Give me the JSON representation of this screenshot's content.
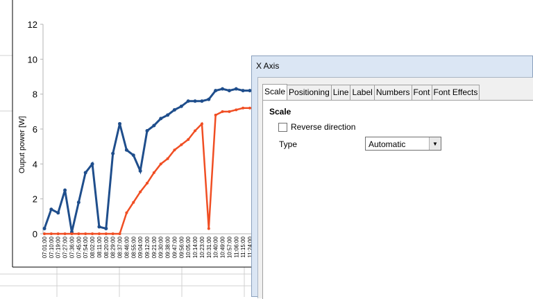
{
  "chart_data": {
    "type": "line",
    "ylabel": "Ouput power [W]",
    "ylim": [
      0,
      12
    ],
    "yticks": [
      "0",
      "2",
      "4",
      "6",
      "8",
      "10",
      "12"
    ],
    "xticks": [
      "07:01:00",
      "07:10:00",
      "07:19:00",
      "07:27:00",
      "07:36:00",
      "07:45:00",
      "07:54:00",
      "08:02:00",
      "08:11:00",
      "08:20:00",
      "08:29:00",
      "08:37:00",
      "08:46:00",
      "08:55:00",
      "09:04:00",
      "09:12:00",
      "09:21:00",
      "09:30:00",
      "09:38:00",
      "09:47:00",
      "09:56:00",
      "10:05:00",
      "10:14:00",
      "10:23:00",
      "10:31:00",
      "10:40:00",
      "10:49:00",
      "10:57:00",
      "11:06:00",
      "11:15:00",
      "11:24:00"
    ],
    "series": [
      {
        "color": "#1f4e8c",
        "values": [
          0.3,
          1.4,
          1.2,
          2.5,
          0.1,
          1.8,
          3.5,
          4.0,
          0.4,
          0.3,
          4.6,
          6.3,
          4.8,
          4.5,
          3.6,
          5.9,
          6.2,
          6.6,
          6.8,
          7.1,
          7.3,
          7.6,
          7.6,
          7.6,
          7.7,
          8.2,
          8.3,
          8.2,
          8.3,
          8.2,
          8.2
        ]
      },
      {
        "color": "#f04e23",
        "values": [
          0,
          0,
          0,
          0,
          0,
          0,
          0,
          0,
          0,
          0,
          0,
          0,
          1.2,
          1.8,
          2.4,
          2.9,
          3.5,
          4.0,
          4.3,
          4.8,
          5.1,
          5.4,
          5.9,
          6.3,
          0.3,
          6.8,
          7.0,
          7.0,
          7.1,
          7.2,
          7.2
        ]
      }
    ]
  },
  "dialog": {
    "title": "X Axis",
    "tabs": [
      "Scale",
      "Positioning",
      "Line",
      "Label",
      "Numbers",
      "Font",
      "Font Effects"
    ],
    "active_tab": "Scale",
    "section_title": "Scale",
    "reverse_direction_label": "Reverse direction",
    "reverse_direction_checked": false,
    "type_label": "Type",
    "type_value": "Automatic"
  }
}
